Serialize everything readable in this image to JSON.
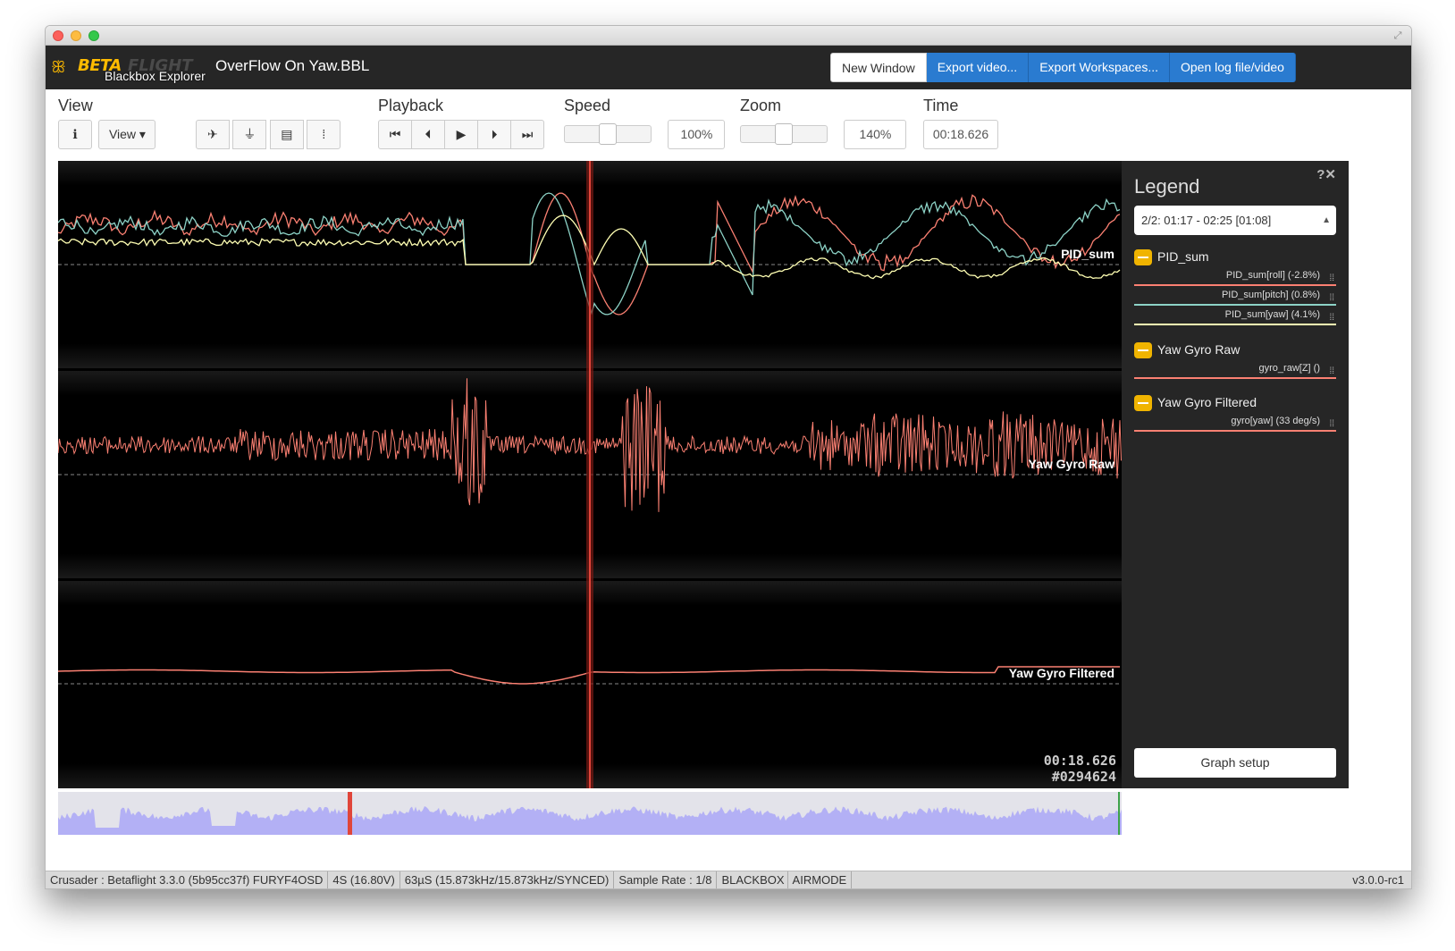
{
  "app": {
    "logo_beta": "BETA",
    "logo_flight": "FLIGHT",
    "logo_sub": "Blackbox Explorer",
    "filename": "OverFlow On Yaw.BBL"
  },
  "top_buttons": [
    "New Window",
    "Export video...",
    "Export Workspaces...",
    "Open log file/video"
  ],
  "toolbar": {
    "view_label": "View",
    "view_dropdown": "View ▾",
    "playback_label": "Playback",
    "speed_label": "Speed",
    "speed_value": "100%",
    "zoom_label": "Zoom",
    "zoom_value": "140%",
    "time_label": "Time",
    "time_value": "00:18.626"
  },
  "graph": {
    "sections": [
      {
        "label": "PID_sum"
      },
      {
        "label": "Yaw Gyro Raw"
      },
      {
        "label": "Yaw Gyro Filtered"
      }
    ],
    "cursor_time": "00:18.626",
    "cursor_frame": "#0294624",
    "colors": {
      "roll": "#fb8072",
      "pitch": "#8dd3c7",
      "yaw": "#ffffb3",
      "gyro": "#fb8072",
      "cursor": "#e0453a"
    }
  },
  "legend": {
    "title": "Legend",
    "close": "?✕",
    "range": "2/2: 01:17 - 02:25 [01:08]",
    "groups": [
      {
        "name": "PID_sum",
        "items": [
          {
            "label": "PID_sum[roll] (-2.8%)",
            "color": "#fb8072"
          },
          {
            "label": "PID_sum[pitch] (0.8%)",
            "color": "#8dd3c7"
          },
          {
            "label": "PID_sum[yaw] (4.1%)",
            "color": "#ffffb3"
          }
        ]
      },
      {
        "name": "Yaw Gyro Raw",
        "items": [
          {
            "label": "gyro_raw[Z] ()",
            "color": "#fb8072"
          }
        ]
      },
      {
        "name": "Yaw Gyro Filtered",
        "items": [
          {
            "label": "gyro[yaw] (33 deg/s)",
            "color": "#fb8072"
          }
        ]
      }
    ],
    "graph_setup": "Graph setup"
  },
  "status": [
    "Crusader : Betaflight 3.3.0 (5b95cc37f) FURYF4OSD",
    "4S (16.80V)",
    "63µS (15.873kHz/15.873kHz/SYNCED)",
    "Sample Rate : 1/8",
    "BLACKBOX",
    "AIRMODE"
  ],
  "version": "v3.0.0-rc1"
}
